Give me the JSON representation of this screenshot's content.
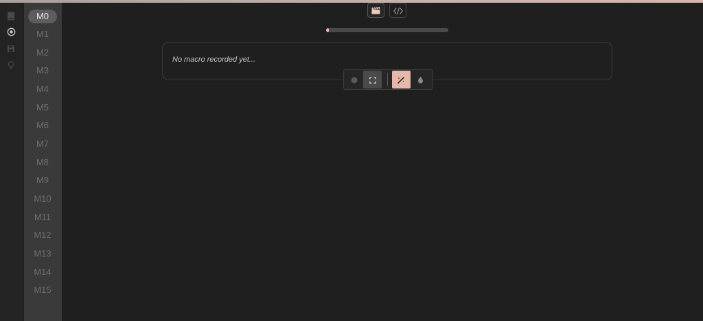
{
  "icon_rail": {
    "items": [
      {
        "icon": "book-icon"
      },
      {
        "icon": "record-target-icon"
      },
      {
        "icon": "save-icon"
      },
      {
        "icon": "lightbulb-icon"
      }
    ]
  },
  "macro_list": {
    "items": [
      "M0",
      "M1",
      "M2",
      "M3",
      "M4",
      "M5",
      "M6",
      "M7",
      "M8",
      "M9",
      "M10",
      "M11",
      "M12",
      "M13",
      "M14",
      "M15"
    ],
    "selected": "M0"
  },
  "view_tabs": [
    {
      "icon": "clapperboard-icon",
      "active": true
    },
    {
      "icon": "code-icon",
      "active": false
    }
  ],
  "progress": {
    "value": 0.02
  },
  "macro_panel": {
    "empty_text": "No macro recorded yet..."
  },
  "toolbar": {
    "buttons": [
      {
        "icon": "record-icon"
      },
      {
        "icon": "fullscreen-icon"
      },
      {
        "icon": "magic-wand-icon"
      },
      {
        "icon": "drop-icon"
      }
    ]
  },
  "colors": {
    "background": "#1f1f1f",
    "sidebar": "#3a3a3a",
    "accent": "#e6b8ac"
  }
}
